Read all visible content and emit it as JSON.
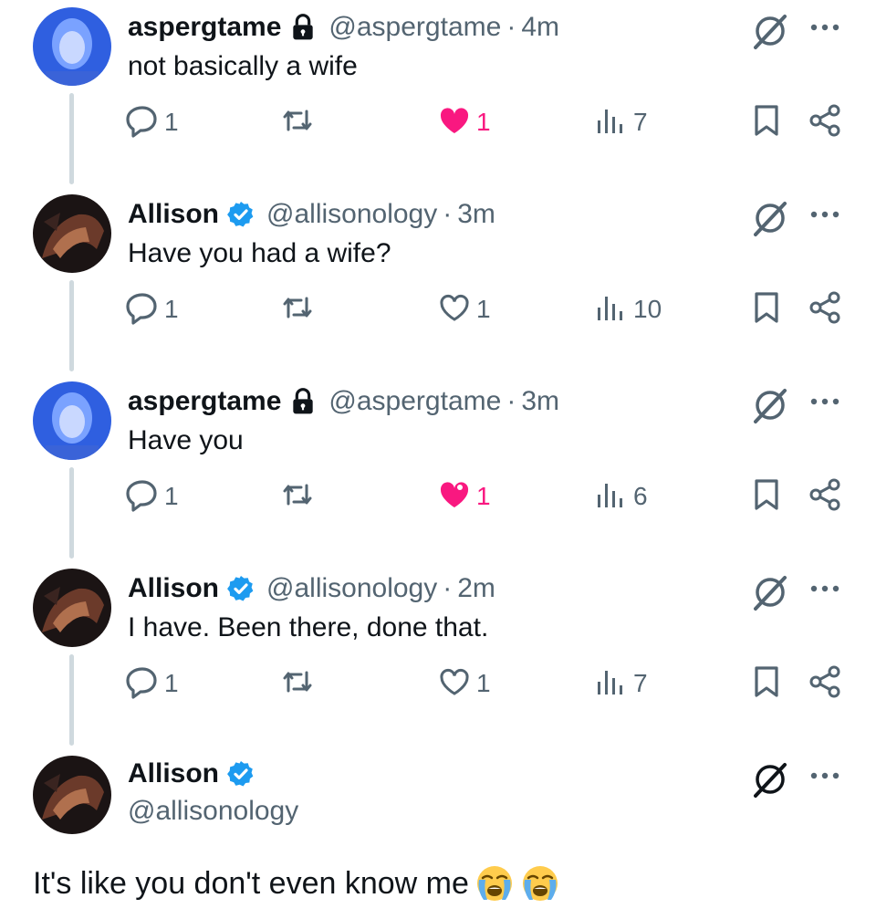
{
  "tweets": [
    {
      "name": "aspergtame",
      "handle": "@aspergtame",
      "dot": "·",
      "time": "4m",
      "text": "not basically a wife",
      "badge_icon": "lock-icon",
      "liked": true,
      "counts": {
        "reply": "1",
        "retweet": "",
        "like": "1",
        "views": "7"
      }
    },
    {
      "name": "Allison",
      "handle": "@allisonology",
      "dot": "·",
      "time": "3m",
      "text": "Have you had a wife?",
      "badge_icon": "verified-badge-icon",
      "liked": false,
      "counts": {
        "reply": "1",
        "retweet": "",
        "like": "1",
        "views": "10"
      }
    },
    {
      "name": "aspergtame",
      "handle": "@aspergtame",
      "dot": "·",
      "time": "3m",
      "text": "Have you",
      "badge_icon": "lock-icon",
      "liked": true,
      "counts": {
        "reply": "1",
        "retweet": "",
        "like": "1",
        "views": "6"
      }
    },
    {
      "name": "Allison",
      "handle": "@allisonology",
      "dot": "·",
      "time": "2m",
      "text": "I have. Been there, done that.",
      "badge_icon": "verified-badge-icon",
      "liked": false,
      "counts": {
        "reply": "1",
        "retweet": "",
        "like": "1",
        "views": "7"
      }
    }
  ],
  "final": {
    "name": "Allison",
    "handle": "@allisonology",
    "text": "It's like you don't even know me",
    "emoji": [
      "loudly-crying-face-emoji",
      "loudly-crying-face-emoji"
    ]
  },
  "colors": {
    "like_active": "#f91880",
    "verified": "#1d9bf0",
    "secondary_text": "#536471",
    "thread_line": "#cfd9de"
  }
}
